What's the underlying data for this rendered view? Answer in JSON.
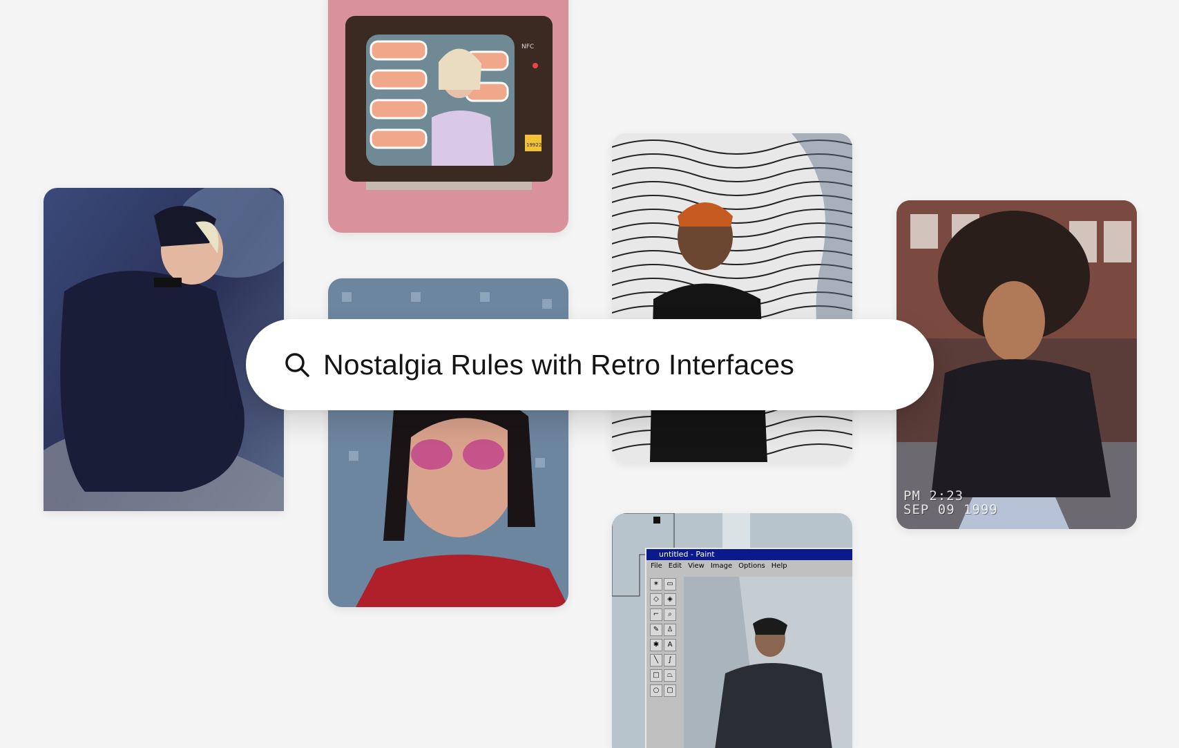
{
  "search": {
    "query": "Nostalgia Rules with Retro Interfaces",
    "icon": "search-icon"
  },
  "gallery": {
    "cards": [
      {
        "id": "card-a",
        "subject": "man-in-beanie-hugging-knees"
      },
      {
        "id": "card-b",
        "subject": "retro-tv-with-sunglasses"
      },
      {
        "id": "card-c",
        "subject": "girl-with-pink-glasses-desktop-icons"
      },
      {
        "id": "card-d",
        "subject": "man-with-wavy-line-background"
      },
      {
        "id": "card-e",
        "subject": "woman-with-curly-hair-vhs"
      },
      {
        "id": "card-f",
        "subject": "paint-window-person"
      }
    ]
  },
  "tv": {
    "brand": "NFC",
    "sticker": "19922"
  },
  "vhs_timestamp": {
    "time": "PM 2:23",
    "date": "SEP 09 1999"
  },
  "paint_window": {
    "title": "untitled - Paint",
    "menu": [
      "File",
      "Edit",
      "View",
      "Image",
      "Options",
      "Help"
    ],
    "tool_text": "A"
  },
  "colors": {
    "background": "#f4f4f4",
    "search_bg": "#ffffff",
    "search_text": "#141414",
    "paint_titlebar": "#0a1a8c"
  }
}
